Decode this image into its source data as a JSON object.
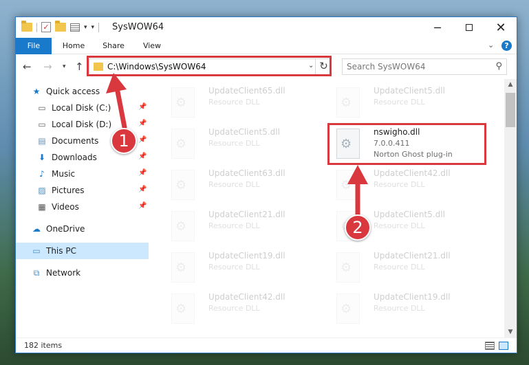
{
  "window": {
    "title": "SysWOW64",
    "controls": {
      "minimize": "─",
      "close": "✕"
    }
  },
  "ribbon": {
    "tabs": [
      "File",
      "Home",
      "Share",
      "View"
    ]
  },
  "address_bar": {
    "path": "C:\\Windows\\SysWOW64",
    "search_placeholder": "Search SysWOW64"
  },
  "sidebar": {
    "items": [
      {
        "label": "Quick access",
        "icon": "star-icon",
        "pinned": false
      },
      {
        "label": "Local Disk (C:)",
        "icon": "drive-icon",
        "pinned": true
      },
      {
        "label": "Local Disk (D:)",
        "icon": "drive-icon",
        "pinned": true
      },
      {
        "label": "Documents",
        "icon": "document-icon",
        "pinned": true
      },
      {
        "label": "Downloads",
        "icon": "download-icon",
        "pinned": true
      },
      {
        "label": "Music",
        "icon": "music-icon",
        "pinned": true
      },
      {
        "label": "Pictures",
        "icon": "picture-icon",
        "pinned": true
      },
      {
        "label": "Videos",
        "icon": "video-icon",
        "pinned": true
      },
      {
        "label": "OneDrive",
        "icon": "cloud-icon",
        "pinned": false
      },
      {
        "label": "This PC",
        "icon": "computer-icon",
        "pinned": false,
        "selected": true
      },
      {
        "label": "Network",
        "icon": "network-icon",
        "pinned": false
      }
    ]
  },
  "files": {
    "left": [
      {
        "name": "UpdateClient65.dll",
        "type": "Resource DLL"
      },
      {
        "name": "UpdateClient5.dll",
        "type": "Resource DLL"
      },
      {
        "name": "UpdateClient63.dll",
        "type": "Resource DLL"
      },
      {
        "name": "UpdateClient21.dll",
        "type": "Resource DLL"
      },
      {
        "name": "UpdateClient19.dll",
        "type": "Resource DLL"
      },
      {
        "name": "UpdateClient42.dll",
        "type": "Resource DLL"
      }
    ],
    "right": [
      {
        "name": "UpdateClient5.dll",
        "type": "Resource DLL"
      },
      {
        "name": "UpdateClient42.dll",
        "type": "Resource DLL"
      },
      {
        "name": "UpdateClient5.dll",
        "type": "Resource DLL"
      },
      {
        "name": "UpdateClient21.dll",
        "type": "Resource DLL"
      },
      {
        "name": "UpdateClient19.dll",
        "type": "Resource DLL"
      }
    ],
    "highlighted": {
      "name": "nswigho.dll",
      "version": "7.0.0.411",
      "description": "Norton Ghost plug-in"
    }
  },
  "status": {
    "item_count": "182 items"
  },
  "callouts": [
    "1",
    "2"
  ],
  "colors": {
    "accent": "#1979ca",
    "annotation_red": "#d9383e",
    "selection": "#cce8ff"
  }
}
